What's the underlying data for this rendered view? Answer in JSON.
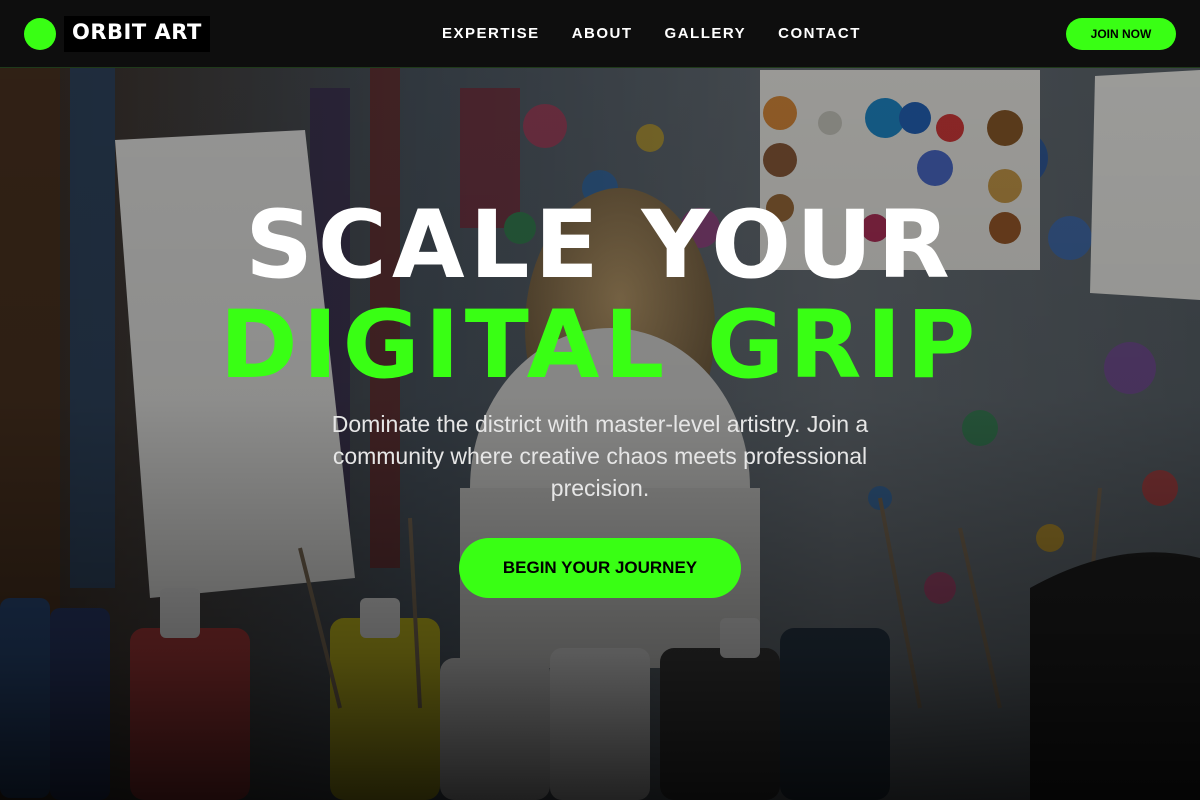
{
  "brand": {
    "name": "ORBIT ART",
    "accent_color": "#39ff14"
  },
  "nav": {
    "links": [
      {
        "label": "EXPERTISE"
      },
      {
        "label": "ABOUT"
      },
      {
        "label": "GALLERY"
      },
      {
        "label": "CONTACT"
      }
    ],
    "cta_label": "JOIN NOW"
  },
  "hero": {
    "headline_line1": "SCALE YOUR",
    "headline_line2": "DIGITAL GRIP",
    "subtext": "Dominate the district with master-level artistry. Join a community where creative chaos meets professional precision.",
    "cta_label": "BEGIN YOUR JOURNEY",
    "background_image": "art-studio-paint-splattered-photo"
  }
}
